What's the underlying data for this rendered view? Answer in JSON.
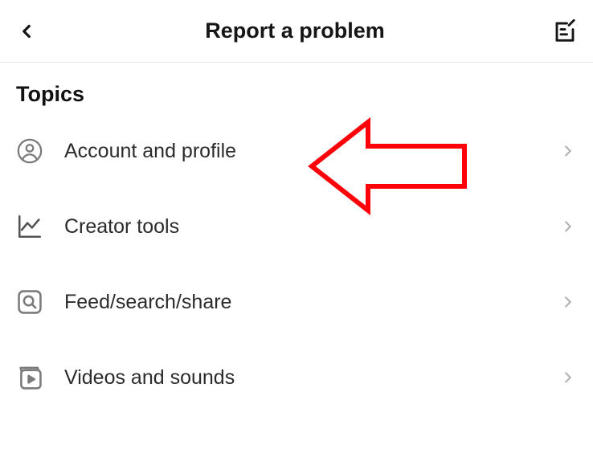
{
  "header": {
    "title": "Report a problem"
  },
  "section": {
    "title": "Topics"
  },
  "topics": [
    {
      "icon": "user-circle-icon",
      "label": "Account and profile"
    },
    {
      "icon": "chart-line-icon",
      "label": "Creator tools"
    },
    {
      "icon": "search-square-icon",
      "label": "Feed/search/share"
    },
    {
      "icon": "video-play-icon",
      "label": "Videos and sounds"
    }
  ],
  "annotation": {
    "type": "arrow",
    "color": "#ff0008",
    "target": "Account and profile"
  }
}
